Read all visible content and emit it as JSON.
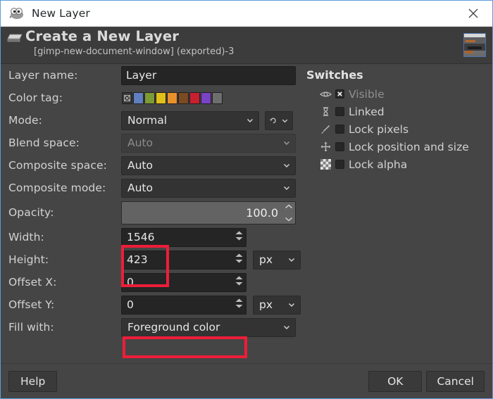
{
  "window": {
    "title": "New Layer",
    "title_icon": "gimp-wilber-icon",
    "close_icon": "close-icon",
    "border_color": "#5b9dd9"
  },
  "banner": {
    "icon": "layer-stack-icon",
    "heading": "Create a New Layer",
    "subheading": "[gimp-new-document-window] (exported)-3",
    "thumbnail": "image-thumbnail"
  },
  "form": {
    "layer_name": {
      "label": "Layer name:",
      "value": "Layer"
    },
    "color_tag": {
      "label": "Color tag:",
      "selected": "none",
      "options": [
        {
          "name": "none",
          "color": "#373737"
        },
        {
          "name": "blue",
          "color": "#5f7fbe"
        },
        {
          "name": "green",
          "color": "#7c9b34"
        },
        {
          "name": "yellow",
          "color": "#e0c019"
        },
        {
          "name": "orange",
          "color": "#e8912a"
        },
        {
          "name": "brown",
          "color": "#7b4a21"
        },
        {
          "name": "red",
          "color": "#c8202f"
        },
        {
          "name": "violet",
          "color": "#7a42c4"
        },
        {
          "name": "gray",
          "color": "#6e6e6e"
        }
      ]
    },
    "mode": {
      "label": "Mode:",
      "value": "Normal",
      "extra_icon": "switch-mode-icon"
    },
    "blend_space": {
      "label": "Blend space:",
      "value": "Auto",
      "disabled": true
    },
    "composite_space": {
      "label": "Composite space:",
      "value": "Auto"
    },
    "composite_mode": {
      "label": "Composite mode:",
      "value": "Auto"
    },
    "opacity": {
      "label": "Opacity:",
      "value": "100.0",
      "percent": 100
    },
    "width": {
      "label": "Width:",
      "value": "1546"
    },
    "height": {
      "label": "Height:",
      "value": "423",
      "unit": "px"
    },
    "offset_x": {
      "label": "Offset X:",
      "value": "0"
    },
    "offset_y": {
      "label": "Offset Y:",
      "value": "0",
      "unit": "px"
    },
    "fill_with": {
      "label": "Fill with:",
      "value": "Foreground color"
    }
  },
  "switches": {
    "title": "Switches",
    "items": [
      {
        "icon": "eye-icon",
        "label": "Visible",
        "checked": true,
        "dim": true
      },
      {
        "icon": "chain-link-icon",
        "label": "Linked",
        "checked": false,
        "dim": false
      },
      {
        "icon": "paintbrush-icon",
        "label": "Lock pixels",
        "checked": false,
        "dim": false
      },
      {
        "icon": "move-arrows-icon",
        "label": "Lock position and size",
        "checked": false,
        "dim": false
      },
      {
        "icon": "checkerboard-icon",
        "label": "Lock alpha",
        "checked": false,
        "dim": false
      }
    ]
  },
  "highlights": {
    "color": "#ee1d39",
    "boxes": [
      "size-fields-highlight",
      "fill-with-highlight"
    ]
  },
  "actions": {
    "help": "Help",
    "ok": "OK",
    "cancel": "Cancel"
  }
}
